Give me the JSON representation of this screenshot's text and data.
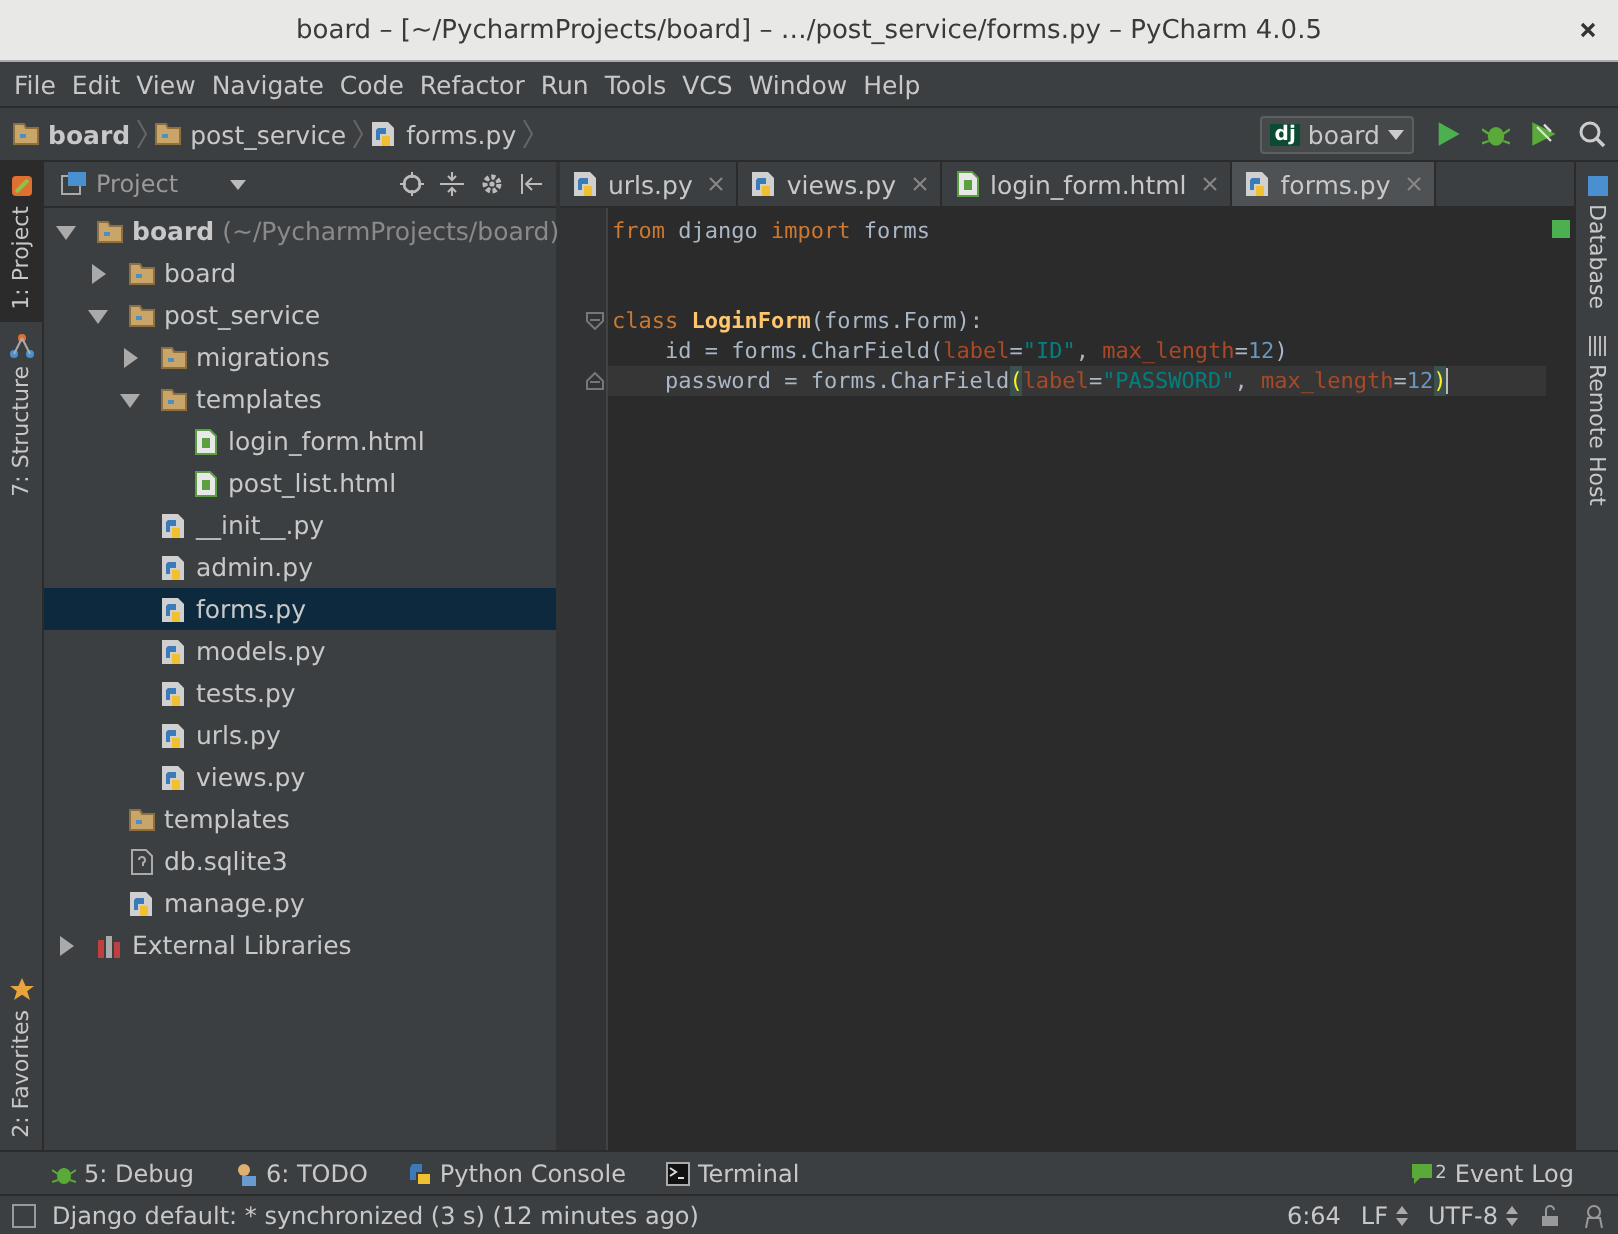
{
  "window": {
    "title": "board – [~/PycharmProjects/board] – …/post_service/forms.py – PyCharm 4.0.5"
  },
  "menu": [
    "File",
    "Edit",
    "View",
    "Navigate",
    "Code",
    "Refactor",
    "Run",
    "Tools",
    "VCS",
    "Window",
    "Help"
  ],
  "breadcrumbs": [
    {
      "label": "board",
      "kind": "folder"
    },
    {
      "label": "post_service",
      "kind": "folder"
    },
    {
      "label": "forms.py",
      "kind": "py"
    }
  ],
  "run_config": {
    "badge": "dj",
    "label": "board"
  },
  "left_strip": [
    {
      "label": "1: Project",
      "selected": true,
      "kind": "project"
    },
    {
      "label": "7: Structure",
      "selected": false,
      "kind": "structure"
    }
  ],
  "left_strip_bottom": [
    {
      "label": "2: Favorites",
      "selected": false,
      "kind": "star"
    }
  ],
  "right_strip": [
    {
      "label": "Database",
      "kind": "db"
    },
    {
      "label": "Remote Host",
      "kind": "host"
    }
  ],
  "project_panel": {
    "title": "Project"
  },
  "tree": [
    {
      "label": "board",
      "hint": "(~/PycharmProjects/board)",
      "kind": "folder",
      "expanded": true,
      "selected": false,
      "children": [
        {
          "label": "board",
          "kind": "folder",
          "expanded": false,
          "selected": false
        },
        {
          "label": "post_service",
          "kind": "folder",
          "expanded": true,
          "selected": false,
          "children": [
            {
              "label": "migrations",
              "kind": "folder",
              "expanded": false,
              "selected": false
            },
            {
              "label": "templates",
              "kind": "folder",
              "expanded": true,
              "selected": false,
              "children": [
                {
                  "label": "login_form.html",
                  "kind": "html",
                  "selected": false
                },
                {
                  "label": "post_list.html",
                  "kind": "html",
                  "selected": false
                }
              ]
            },
            {
              "label": "__init__.py",
              "kind": "py",
              "selected": false
            },
            {
              "label": "admin.py",
              "kind": "py",
              "selected": false
            },
            {
              "label": "forms.py",
              "kind": "py",
              "selected": true
            },
            {
              "label": "models.py",
              "kind": "py",
              "selected": false
            },
            {
              "label": "tests.py",
              "kind": "py",
              "selected": false
            },
            {
              "label": "urls.py",
              "kind": "py",
              "selected": false
            },
            {
              "label": "views.py",
              "kind": "py",
              "selected": false
            }
          ]
        },
        {
          "label": "templates",
          "kind": "folder",
          "selected": false
        },
        {
          "label": "db.sqlite3",
          "kind": "unknown",
          "selected": false
        },
        {
          "label": "manage.py",
          "kind": "py",
          "selected": false
        }
      ]
    },
    {
      "label": "External Libraries",
      "kind": "library",
      "expanded": false,
      "selected": false
    }
  ],
  "tabs": [
    {
      "label": "urls.py",
      "kind": "py",
      "selected": false
    },
    {
      "label": "views.py",
      "kind": "py",
      "selected": false
    },
    {
      "label": "login_form.html",
      "kind": "html",
      "selected": false
    },
    {
      "label": "forms.py",
      "kind": "py",
      "selected": true
    }
  ],
  "code": [
    {
      "kind": "code",
      "current": false,
      "tokens": [
        {
          "text": "from",
          "kind": "kw"
        },
        {
          "text": " django ",
          "kind": "plain"
        },
        {
          "text": "import",
          "kind": "kw"
        },
        {
          "text": " forms",
          "kind": "plain"
        }
      ]
    },
    {
      "kind": "blank"
    },
    {
      "kind": "blank"
    },
    {
      "kind": "code",
      "current": false,
      "fold": {
        "kind": "start"
      },
      "tokens": [
        {
          "text": "class ",
          "kind": "kw"
        },
        {
          "text": "LoginForm",
          "kind": "cls"
        },
        {
          "text": "(forms.Form):",
          "kind": "plain"
        }
      ]
    },
    {
      "kind": "code",
      "current": false,
      "tokens": [
        {
          "text": "    id = forms.CharField(",
          "kind": "plain"
        },
        {
          "text": "label",
          "kind": "param"
        },
        {
          "text": "=",
          "kind": "plain"
        },
        {
          "text": "\"ID\"",
          "kind": "str"
        },
        {
          "text": ", ",
          "kind": "plain"
        },
        {
          "text": "max_length",
          "kind": "param"
        },
        {
          "text": "=",
          "kind": "plain"
        },
        {
          "text": "12",
          "kind": "num"
        },
        {
          "text": ")",
          "kind": "plain"
        }
      ]
    },
    {
      "kind": "code",
      "current": true,
      "fold": {
        "kind": "end"
      },
      "tokens": [
        {
          "text": "    password = forms.CharField",
          "kind": "plain"
        },
        {
          "text": "(",
          "kind": "brace"
        },
        {
          "text": "label",
          "kind": "param"
        },
        {
          "text": "=",
          "kind": "plain"
        },
        {
          "text": "\"PASSWORD\"",
          "kind": "str"
        },
        {
          "text": ", ",
          "kind": "plain"
        },
        {
          "text": "max_length",
          "kind": "param"
        },
        {
          "text": "=",
          "kind": "plain"
        },
        {
          "text": "12",
          "kind": "num"
        },
        {
          "text": ")",
          "kind": "brace"
        }
      ]
    }
  ],
  "bottom_tools": [
    {
      "label": "5: Debug",
      "kind": "debug"
    },
    {
      "label": "6: TODO",
      "kind": "todo"
    },
    {
      "label": "Python Console",
      "kind": "python"
    },
    {
      "label": "Terminal",
      "kind": "terminal"
    }
  ],
  "event_log": {
    "count": "2",
    "label": "Event Log"
  },
  "status_bar": {
    "message": "Django default: * synchronized (3 s) (12 minutes ago)",
    "position": "6:64",
    "line_sep": "LF",
    "encoding": "UTF-8"
  }
}
